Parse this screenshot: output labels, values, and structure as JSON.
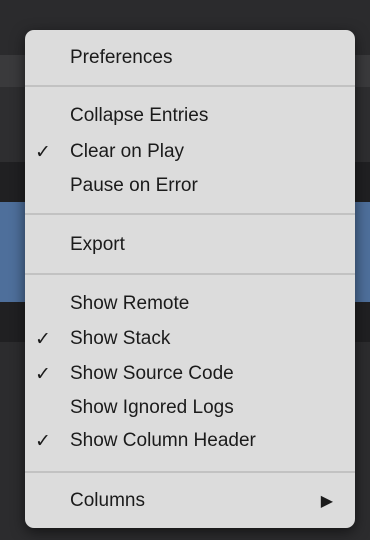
{
  "colors": {
    "menu_background": "#dcdcdc",
    "text": "#1b1b1b",
    "separator": "#c2c2c2",
    "highlight_band": "#4e6f9b"
  },
  "menu": {
    "items": [
      {
        "label": "Preferences",
        "checked": false
      },
      {
        "label": "Collapse Entries",
        "checked": false
      },
      {
        "label": "Clear on Play",
        "checked": true,
        "check_mark": "✓"
      },
      {
        "label": "Pause on Error",
        "checked": false
      },
      {
        "label": "Export",
        "checked": false
      },
      {
        "label": "Show Remote",
        "checked": false
      },
      {
        "label": "Show Stack",
        "checked": true,
        "check_mark": "✓"
      },
      {
        "label": "Show Source Code",
        "checked": true,
        "check_mark": "✓"
      },
      {
        "label": "Show Ignored Logs",
        "checked": false
      },
      {
        "label": "Show Column Header",
        "checked": true,
        "check_mark": "✓"
      },
      {
        "label": "Columns",
        "checked": false,
        "submenu_arrow": "▶"
      }
    ]
  }
}
